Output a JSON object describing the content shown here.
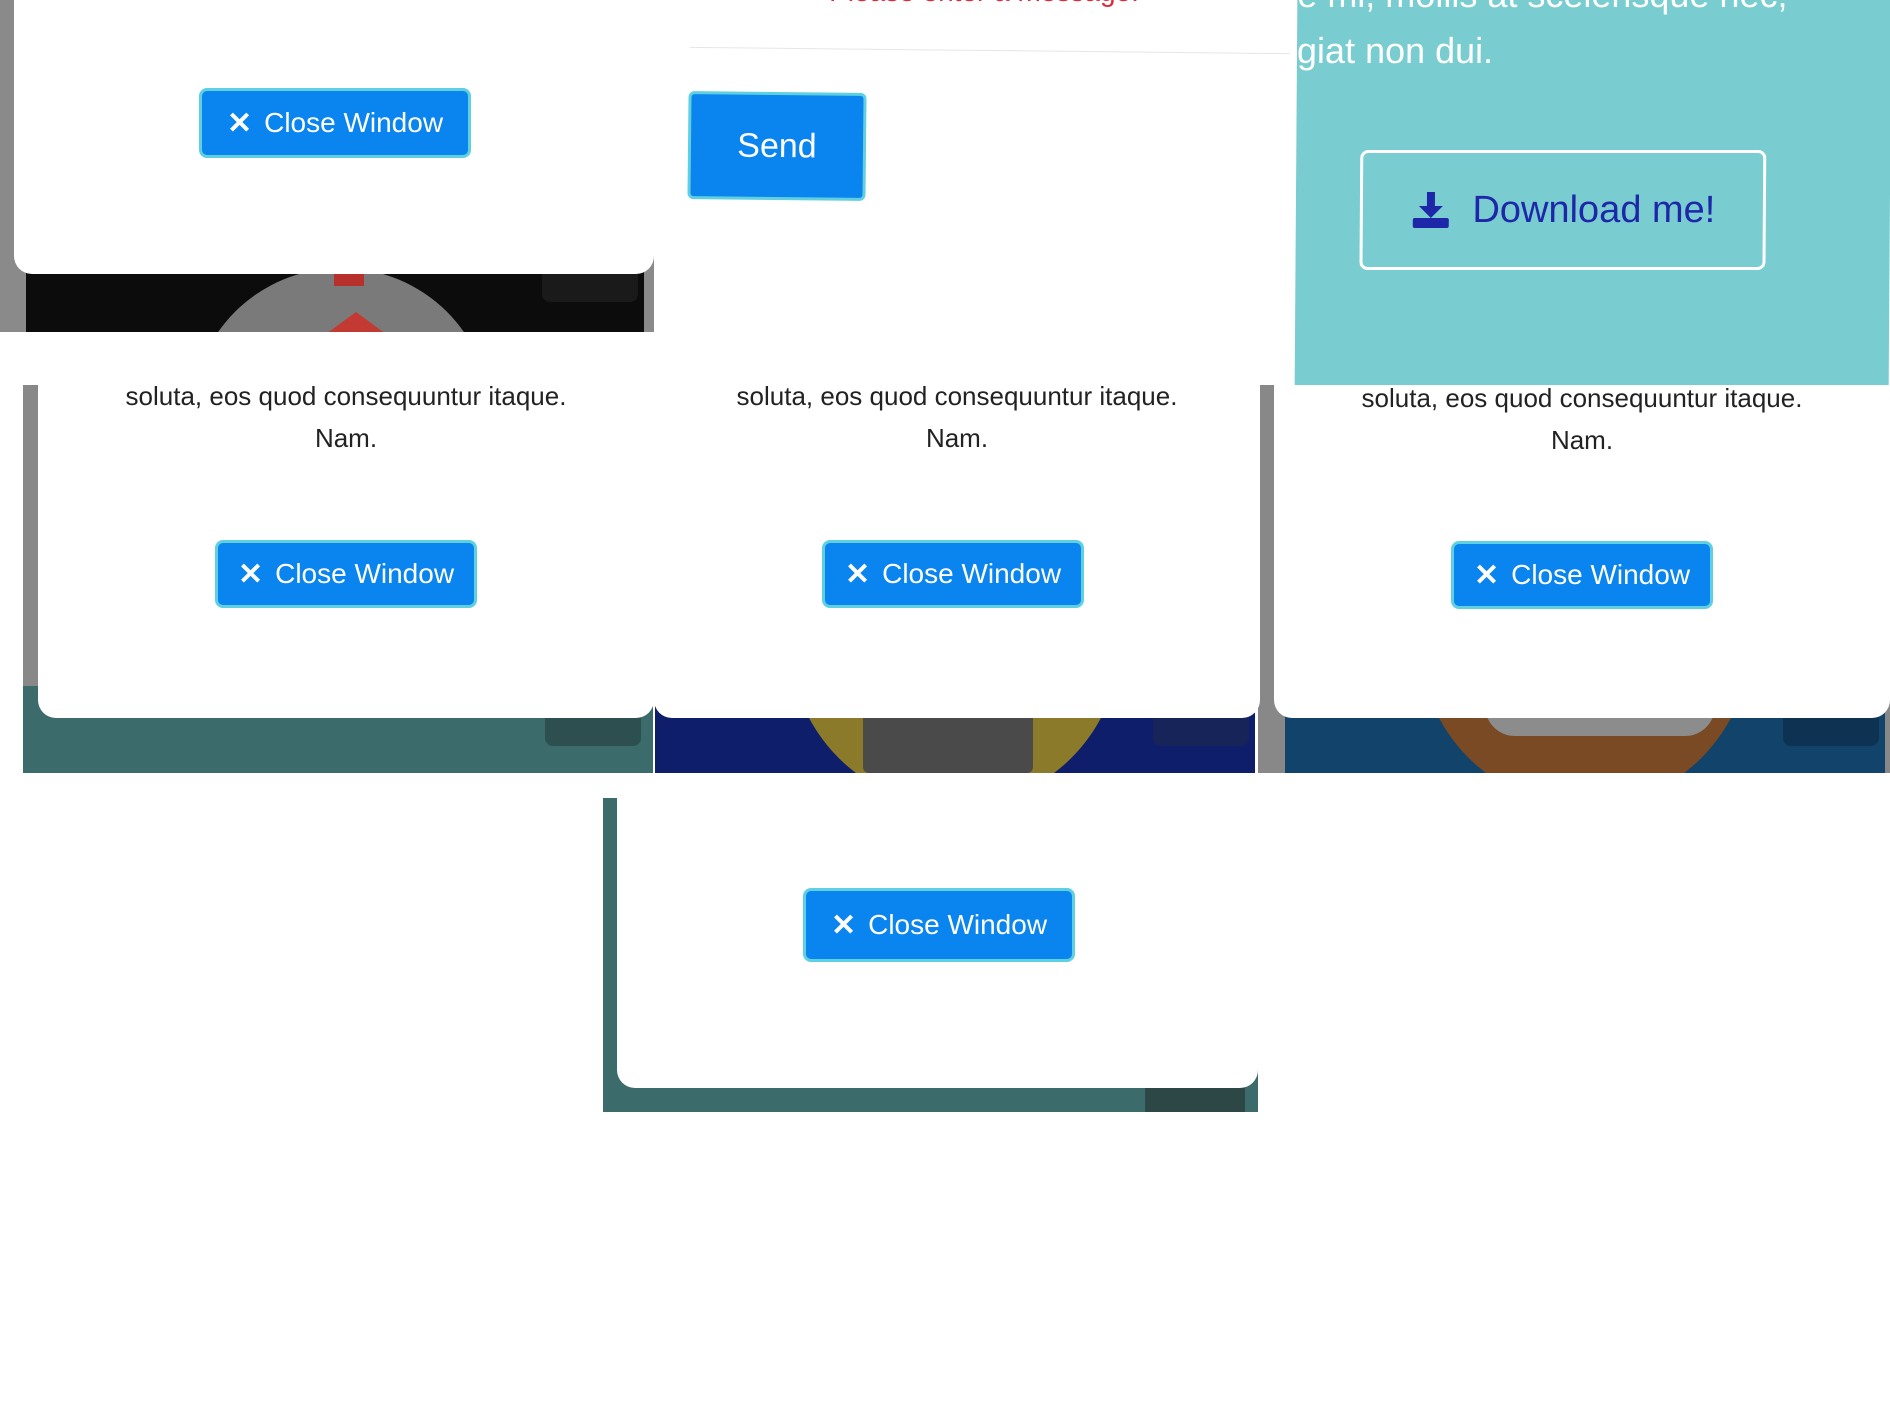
{
  "colors": {
    "accent": "#0a84ee",
    "button_border": "#5fd0e0",
    "teal_panel": "#79cdd1",
    "download_text": "#1d27a8",
    "error_red": "#e0283c"
  },
  "top_left_modal": {
    "close_label": "Close Window",
    "close_icon": "close-x-icon"
  },
  "contact_form": {
    "error_text": "Please enter a message.",
    "send_label": "Send"
  },
  "teal_panel": {
    "text_line_1": "e mi, mollis at scelerisque nec,",
    "text_line_2": "giat non dui.",
    "download_label": "Download me!",
    "download_icon": "download-icon"
  },
  "middle_row": [
    {
      "text_line_1": "soluta, eos quod consequuntur itaque.",
      "text_line_2": "Nam.",
      "close_label": "Close Window"
    },
    {
      "text_line_1": "soluta, eos quod consequuntur itaque.",
      "text_line_2": "Nam.",
      "close_label": "Close Window"
    },
    {
      "text_line_1": "soluta, eos quod consequuntur itaque.",
      "text_line_2": "Nam.",
      "close_label": "Close Window"
    }
  ],
  "bottom_modal": {
    "close_label": "Close Window"
  }
}
